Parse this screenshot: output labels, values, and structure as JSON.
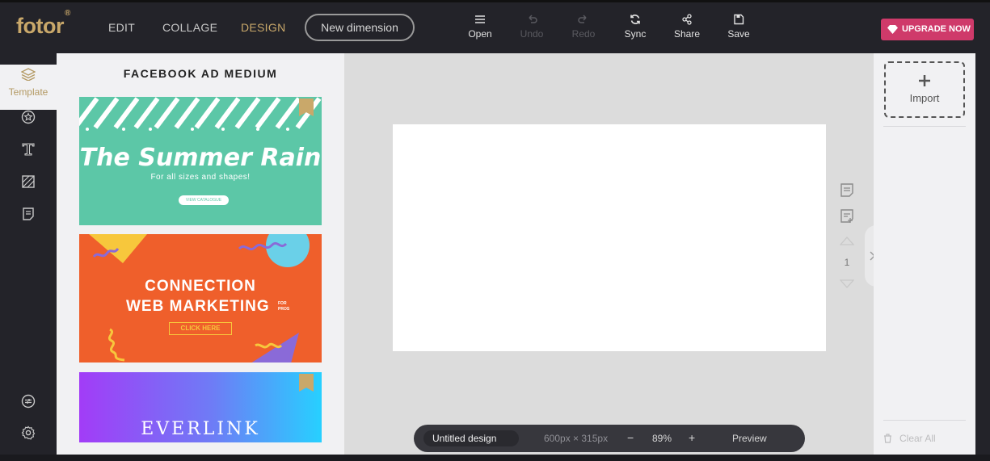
{
  "app": {
    "logo": "fotor"
  },
  "nav": {
    "edit": "EDIT",
    "collage": "COLLAGE",
    "design": "DESIGN",
    "new_dimension": "New dimension"
  },
  "toolbar": {
    "open": "Open",
    "undo": "Undo",
    "redo": "Redo",
    "sync": "Sync",
    "share": "Share",
    "save": "Save"
  },
  "upgrade": {
    "label": "UPGRADE NOW",
    "color": "#cf3a6a"
  },
  "rail": {
    "template_label": "Template",
    "icons": [
      "layers-icon",
      "star-icon",
      "text-icon",
      "background-icon",
      "notes-icon",
      "settings-sliders-icon",
      "gear-icon"
    ]
  },
  "panel": {
    "title": "FACEBOOK AD MEDIUM",
    "templates": [
      {
        "title": "The Summer Rain",
        "subtitle": "For all sizes and shapes!",
        "button": "VIEW CATALOGUE",
        "premium": true
      },
      {
        "line1": "CONNECTION",
        "line2": "WEB MARKETING",
        "tag": "FOR PROS",
        "button": "CLICK HERE",
        "premium": false
      },
      {
        "title": "EVERLINK",
        "premium": true
      }
    ]
  },
  "page": {
    "number": "1"
  },
  "bottombar": {
    "name": "Untitled design",
    "size": "600px × 315px",
    "zoom": "89%",
    "minus": "−",
    "plus": "+",
    "preview": "Preview"
  },
  "right": {
    "import": "Import",
    "clear_all": "Clear All"
  },
  "colors": {
    "accent": "#c9a86a",
    "dark": "#232329",
    "panel": "#f1f1f3"
  }
}
